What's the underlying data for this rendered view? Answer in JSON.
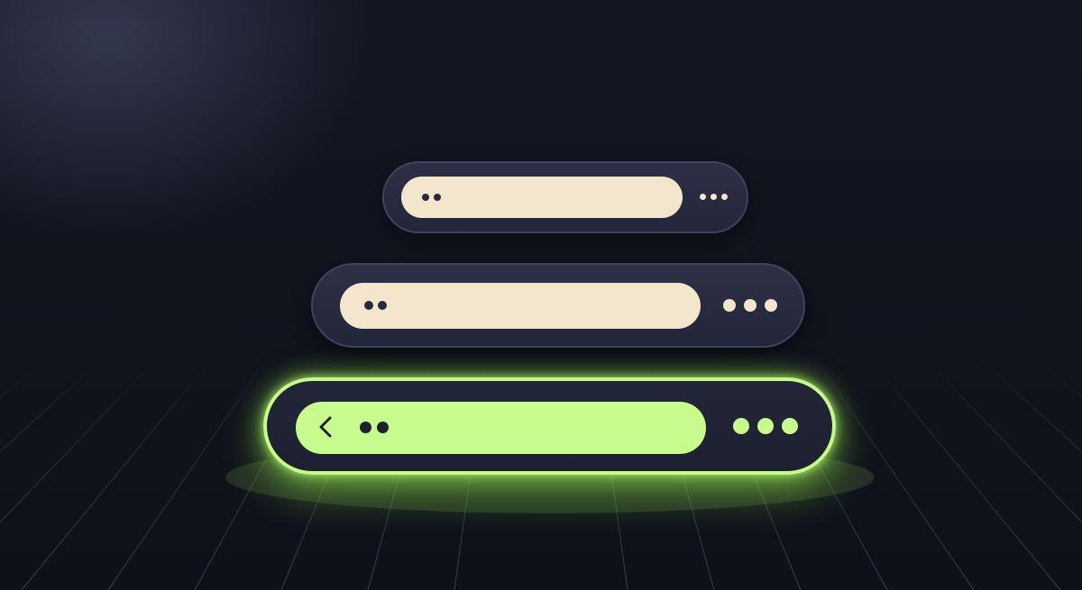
{
  "colors": {
    "background": "#12141f",
    "bar_fill": "#2a2d42",
    "bar_border": "#3f4360",
    "cream_pill": "#f3e6cc",
    "accent_green": "#c8fb8e",
    "grid_line": "#2a2d3d"
  },
  "bars": [
    {
      "id": "bar-small",
      "pill_color": "cream",
      "left_dots": 2,
      "menu_dots": 3,
      "has_back": false,
      "active": false
    },
    {
      "id": "bar-medium",
      "pill_color": "cream",
      "left_dots": 2,
      "menu_dots": 3,
      "has_back": false,
      "active": false
    },
    {
      "id": "bar-large",
      "pill_color": "green",
      "left_dots": 2,
      "menu_dots": 3,
      "has_back": true,
      "active": true
    }
  ],
  "icons": {
    "back": "chevron-left-icon",
    "menu": "more-horizontal-icon"
  }
}
